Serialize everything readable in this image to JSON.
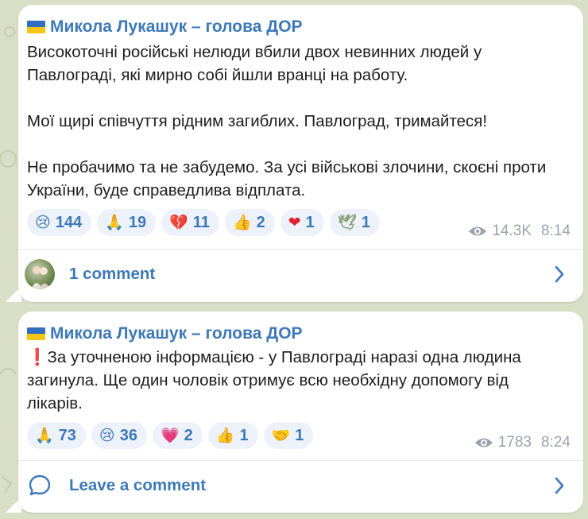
{
  "colors": {
    "accent": "#3d79b8",
    "pill_bg": "#edf2fa",
    "text": "#1d1d1d",
    "meta": "#9aa3ab",
    "background": "#d9dfc6"
  },
  "posts": [
    {
      "author": "Микола Лукашук – голова ДОР",
      "paragraphs": [
        "Високоточні російські нелюди вбили двох невинних людей у Павлограді, які мирно собі йшли вранці на работу.",
        "Мої щирі співчуття рідним загиблих. Павлоград, тримайтеся!",
        "Не пробачимо та не забудемо. За усі військові злочини, скоєні проти України, буде справедлива відплата."
      ],
      "reactions": [
        {
          "emoji": "😢",
          "count": "144"
        },
        {
          "emoji": "🙏",
          "count": "19"
        },
        {
          "emoji": "💔",
          "count": "11"
        },
        {
          "emoji": "👍",
          "count": "2"
        },
        {
          "emoji": "❤",
          "count": "1"
        },
        {
          "emoji": "🕊",
          "count": "1"
        }
      ],
      "views": "14.3K",
      "time": "8:14",
      "comment_label": "1 comment"
    },
    {
      "author": "Микола Лукашук – голова ДОР",
      "paragraphs": [
        "❗За уточненою інформацією - у Павлограді наразі одна людина загинула. Ще один чоловік отримує всю необхідну допомогу від лікарів."
      ],
      "reactions": [
        {
          "emoji": "🙏",
          "count": "73"
        },
        {
          "emoji": "😢",
          "count": "36"
        },
        {
          "emoji": "💗",
          "count": "2"
        },
        {
          "emoji": "👍",
          "count": "1"
        },
        {
          "emoji": "🤝",
          "count": "1"
        }
      ],
      "views": "1783",
      "time": "8:24",
      "comment_label": "Leave a comment"
    }
  ],
  "icons": {
    "views": "eye-icon",
    "open": "chevron-right-icon",
    "comment": "comment-bubble-icon",
    "commenter": "avatar"
  }
}
